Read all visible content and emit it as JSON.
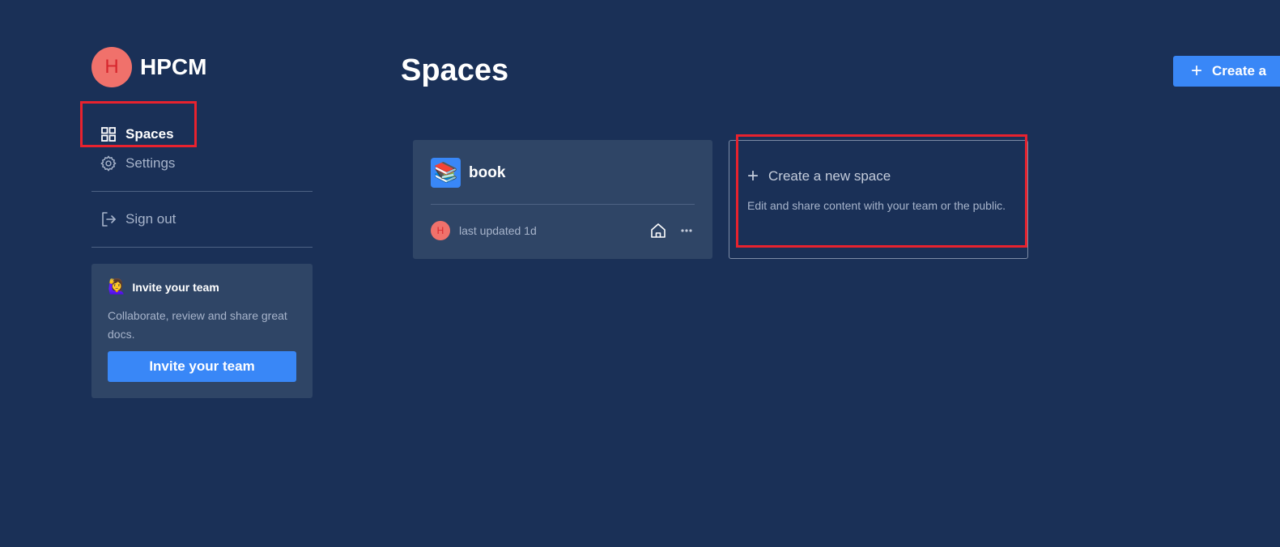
{
  "org": {
    "avatar_letter": "H",
    "name": "HPCM"
  },
  "nav": {
    "spaces_label": "Spaces",
    "settings_label": "Settings",
    "signout_label": "Sign out"
  },
  "invite": {
    "emoji": "🙋‍♀️",
    "title": "Invite your team",
    "text": "Collaborate, review and share great docs.",
    "button_label": "Invite your team"
  },
  "main": {
    "title": "Spaces",
    "create_button_label": "Create a"
  },
  "spaces": [
    {
      "icon_emoji": "📚",
      "name": "book",
      "owner_initial": "H",
      "updated": "last updated 1d"
    }
  ],
  "new_space": {
    "title": "Create a new space",
    "description": "Edit and share content with your team or the public."
  },
  "colors": {
    "background": "#1a3057",
    "card": "#2f4566",
    "accent": "#3987f7",
    "avatar": "#f0716b",
    "highlight": "#e8222e"
  }
}
